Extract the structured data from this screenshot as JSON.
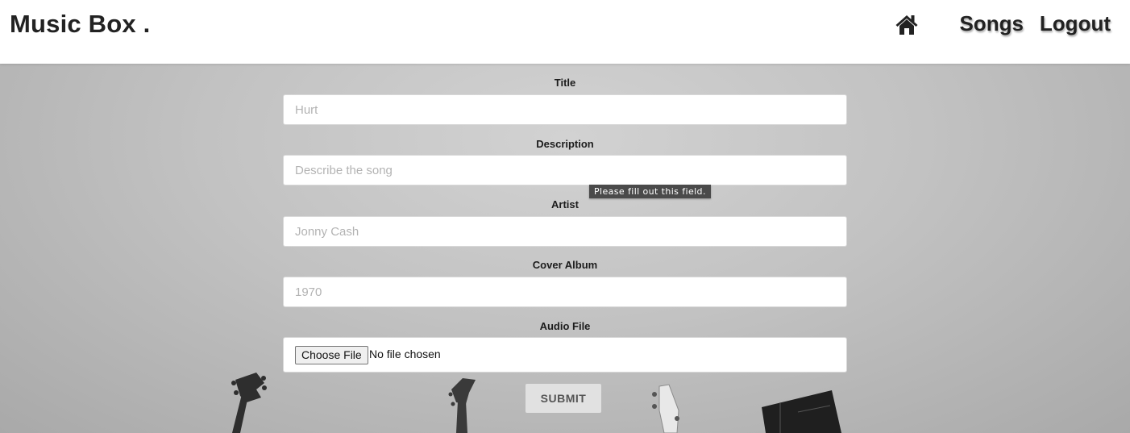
{
  "navbar": {
    "brand": "Music Box .",
    "home_icon": "home-icon",
    "links": {
      "songs": "Songs",
      "logout": "Logout"
    }
  },
  "form": {
    "title": {
      "label": "Title",
      "placeholder": "Hurt",
      "value": ""
    },
    "description": {
      "label": "Description",
      "placeholder": "Describe the song",
      "value": ""
    },
    "artist": {
      "label": "Artist",
      "placeholder": "Jonny Cash",
      "value": ""
    },
    "cover_album": {
      "label": "Cover Album",
      "placeholder": "1970",
      "value": ""
    },
    "audio_file": {
      "label": "Audio File",
      "button": "Choose File",
      "status": "No file chosen"
    },
    "submit_label": "SUBMIT",
    "validation_tooltip": "Please fill out this field."
  },
  "colors": {
    "nav_text": "#222222",
    "background_gray": "#c2c2c2",
    "submit_bg": "#e1e1e1",
    "tooltip_bg": "#4a4a4a"
  }
}
